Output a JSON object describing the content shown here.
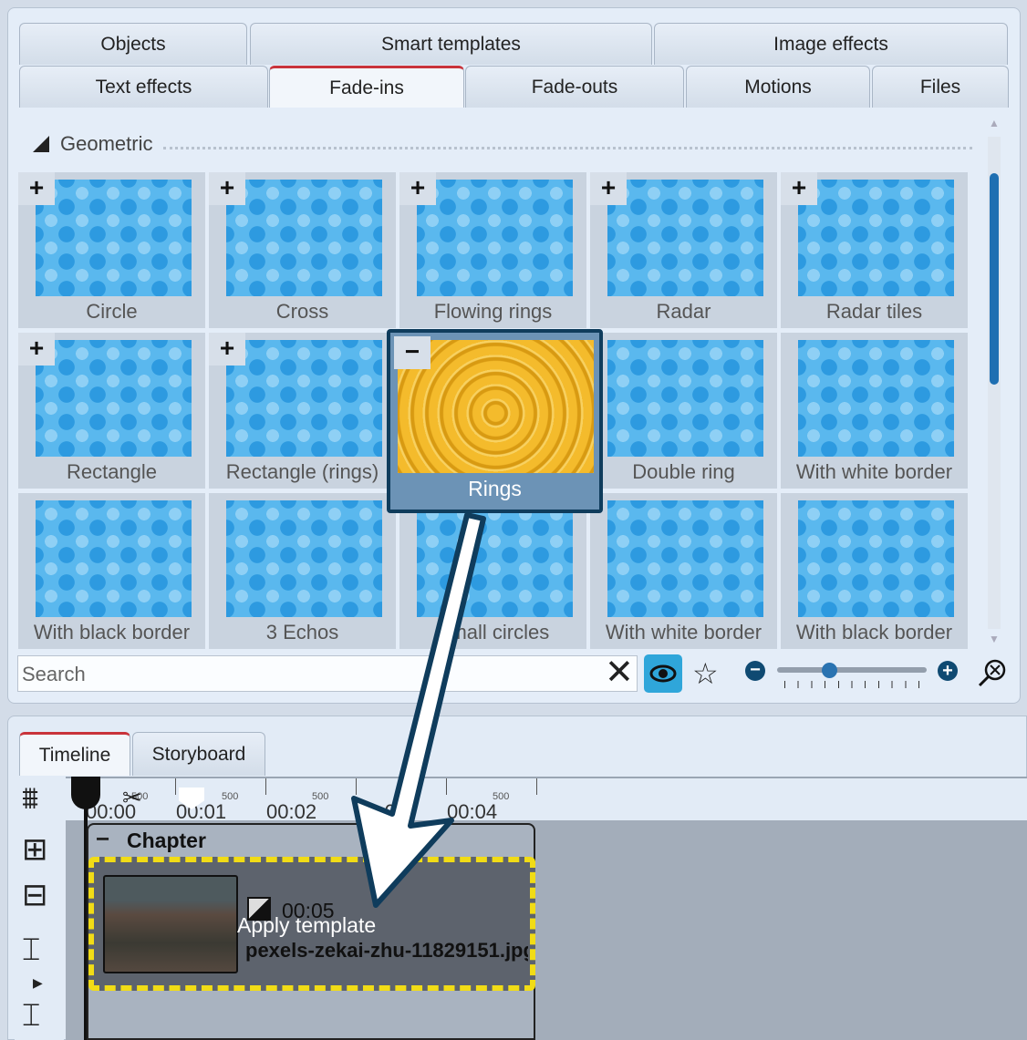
{
  "tabs_row1": [
    "Objects",
    "Smart templates",
    "Image effects"
  ],
  "tabs_row2": [
    "Text effects",
    "Fade-ins",
    "Fade-outs",
    "Motions",
    "Files"
  ],
  "active_tab": "Fade-ins",
  "section": "Geometric",
  "effects": [
    {
      "label": "Circle",
      "add": "+"
    },
    {
      "label": "Cross",
      "add": "+"
    },
    {
      "label": "Flowing rings",
      "add": "+"
    },
    {
      "label": "Radar",
      "add": "+"
    },
    {
      "label": "Radar tiles",
      "add": "+"
    },
    {
      "label": "Rectangle",
      "add": "+"
    },
    {
      "label": "Rectangle (rings)",
      "add": "+"
    },
    {
      "label": "Rings",
      "add": "−"
    },
    {
      "label": "Double ring",
      "add": ""
    },
    {
      "label": "With white border",
      "add": ""
    },
    {
      "label": "With black border",
      "add": ""
    },
    {
      "label": "3 Echos",
      "add": ""
    },
    {
      "label": "Small circles",
      "add": ""
    },
    {
      "label": "With white border",
      "add": ""
    },
    {
      "label": "With black border",
      "add": ""
    }
  ],
  "popup": {
    "label": "Rings",
    "remove": "−"
  },
  "search": {
    "placeholder": "Search"
  },
  "zoom_slider": {
    "value_fraction": 0.35
  },
  "accent": "#2fa6da",
  "bottom_tabs": [
    "Timeline",
    "Storyboard"
  ],
  "ruler": {
    "labels": [
      "00:00",
      "00:01",
      "00:02",
      "00:03",
      "00:04"
    ],
    "sub": "500"
  },
  "chapter": {
    "title": "Chapter",
    "toggle": "−"
  },
  "clip": {
    "duration": "00:05",
    "filename": "pexels-zekai-zhu-11829151.jpg"
  },
  "drag_tooltip": "Apply template"
}
